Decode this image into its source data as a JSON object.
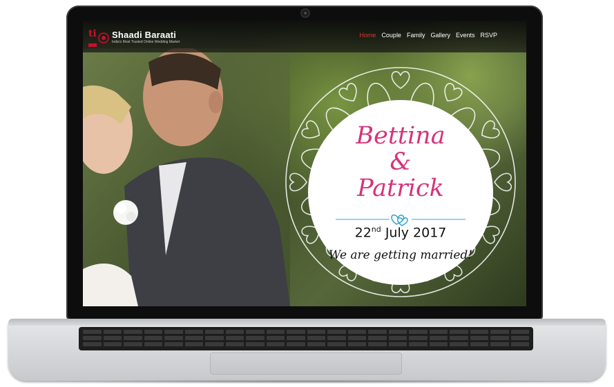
{
  "site": {
    "brand_name": "Shaadi Baraati",
    "brand_tagline": "India's Most Trusted Online Wedding Market",
    "brand_mark_letters": "ti",
    "nav": [
      {
        "label": "Home",
        "active": true
      },
      {
        "label": "Couple",
        "active": false
      },
      {
        "label": "Family",
        "active": false
      },
      {
        "label": "Gallery",
        "active": false
      },
      {
        "label": "Events",
        "active": false
      },
      {
        "label": "RSVP",
        "active": false
      }
    ]
  },
  "invitation": {
    "name1": "Bettina",
    "ampersand": "&",
    "name2": "Patrick",
    "date_day": "22",
    "date_suffix": "nd",
    "date_rest": "July 2017",
    "tagline": "We are getting married!"
  },
  "colors": {
    "accent_pink": "#d6337a",
    "heart_blue": "#3aa7d6",
    "nav_active": "#e0352b",
    "laptop_frame": "#0d0d0d",
    "laptop_base": "#d9dadc"
  },
  "icons": {
    "divider": "double-heart-icon",
    "camera": "webcam-icon"
  }
}
